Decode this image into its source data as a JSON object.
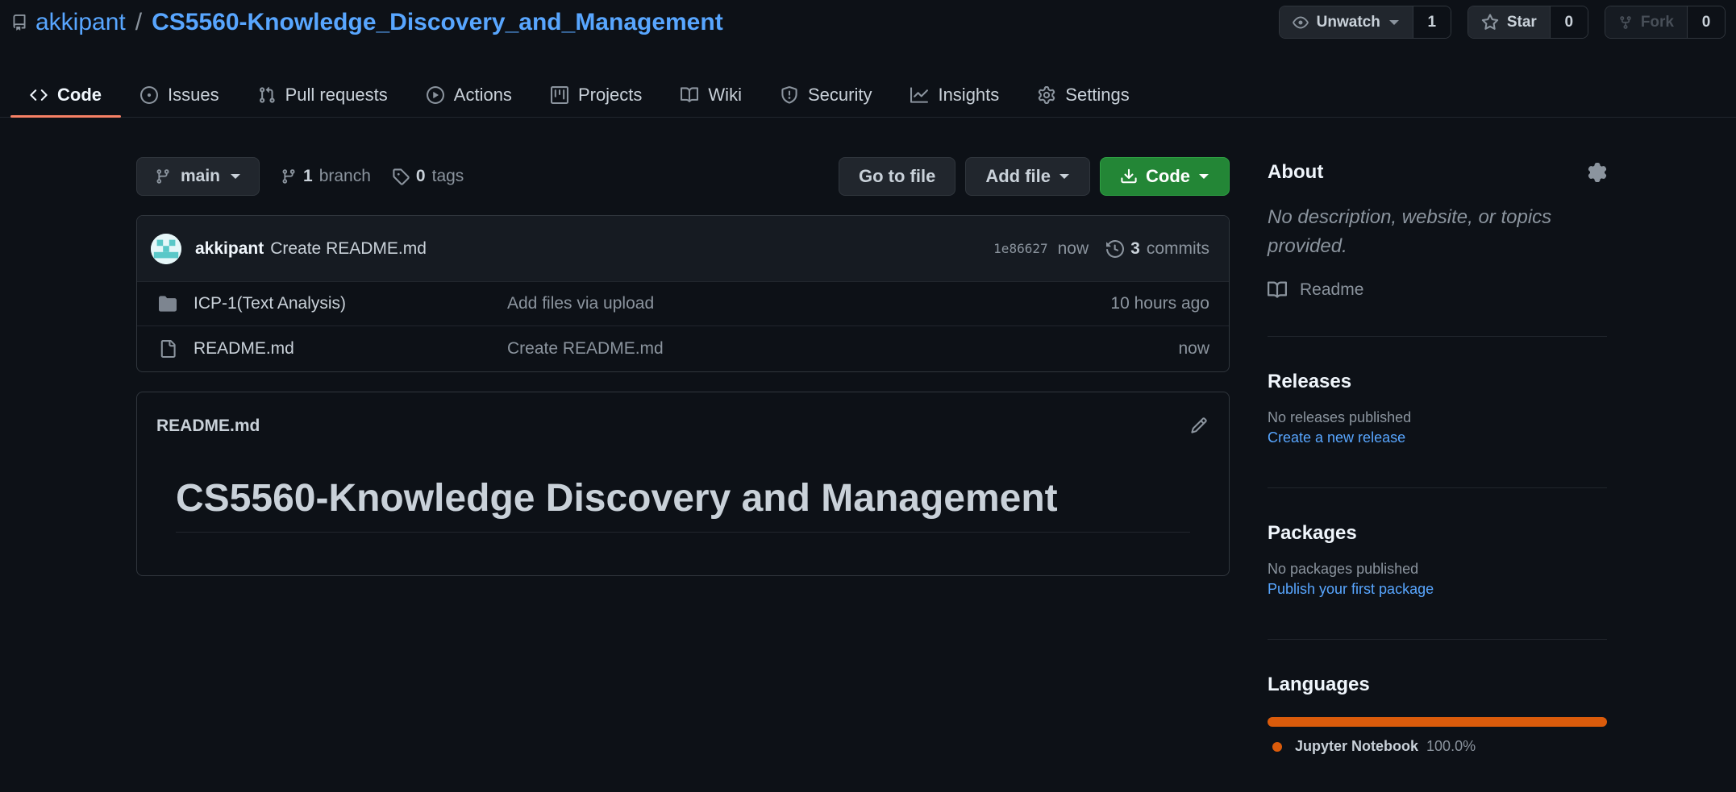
{
  "repo": {
    "owner": "akkipant",
    "separator": "/",
    "name": "CS5560-Knowledge_Discovery_and_Management"
  },
  "actions": {
    "watch_label": "Unwatch",
    "watch_count": "1",
    "star_label": "Star",
    "star_count": "0",
    "fork_label": "Fork",
    "fork_count": "0"
  },
  "tabs": [
    {
      "label": "Code",
      "icon": "code-icon",
      "active": true
    },
    {
      "label": "Issues",
      "icon": "issue-icon"
    },
    {
      "label": "Pull requests",
      "icon": "pull-request-icon"
    },
    {
      "label": "Actions",
      "icon": "play-icon"
    },
    {
      "label": "Projects",
      "icon": "project-icon"
    },
    {
      "label": "Wiki",
      "icon": "book-icon"
    },
    {
      "label": "Security",
      "icon": "shield-icon"
    },
    {
      "label": "Insights",
      "icon": "graph-icon"
    },
    {
      "label": "Settings",
      "icon": "gear-icon"
    }
  ],
  "toolbar": {
    "branch": "main",
    "branch_count": "1",
    "branch_label": "branch",
    "tag_count": "0",
    "tag_label": "tags",
    "go_to_file": "Go to file",
    "add_file": "Add file",
    "code": "Code"
  },
  "latest_commit": {
    "author": "akkipant",
    "message": "Create README.md",
    "sha": "1e86627",
    "when": "now",
    "commit_count": "3",
    "commit_label": "commits"
  },
  "files": [
    {
      "type": "folder",
      "name": "ICP-1(Text Analysis)",
      "message": "Add files via upload",
      "age": "10 hours ago"
    },
    {
      "type": "file",
      "name": "README.md",
      "message": "Create README.md",
      "age": "now"
    }
  ],
  "readme": {
    "filename": "README.md",
    "heading": "CS5560-Knowledge Discovery and Management"
  },
  "sidebar": {
    "about_title": "About",
    "about_desc": "No description, website, or topics provided.",
    "readme_link": "Readme",
    "releases_title": "Releases",
    "releases_empty": "No releases published",
    "releases_link": "Create a new release",
    "packages_title": "Packages",
    "packages_empty": "No packages published",
    "packages_link": "Publish your first package",
    "languages_title": "Languages",
    "languages": [
      {
        "name": "Jupyter Notebook",
        "percent": "100.0%",
        "color": "#da5b0b"
      }
    ]
  },
  "colors": {
    "background": "#0d1117",
    "link": "#58a6ff",
    "primary_button": "#238636",
    "active_tab_underline": "#f78166"
  }
}
